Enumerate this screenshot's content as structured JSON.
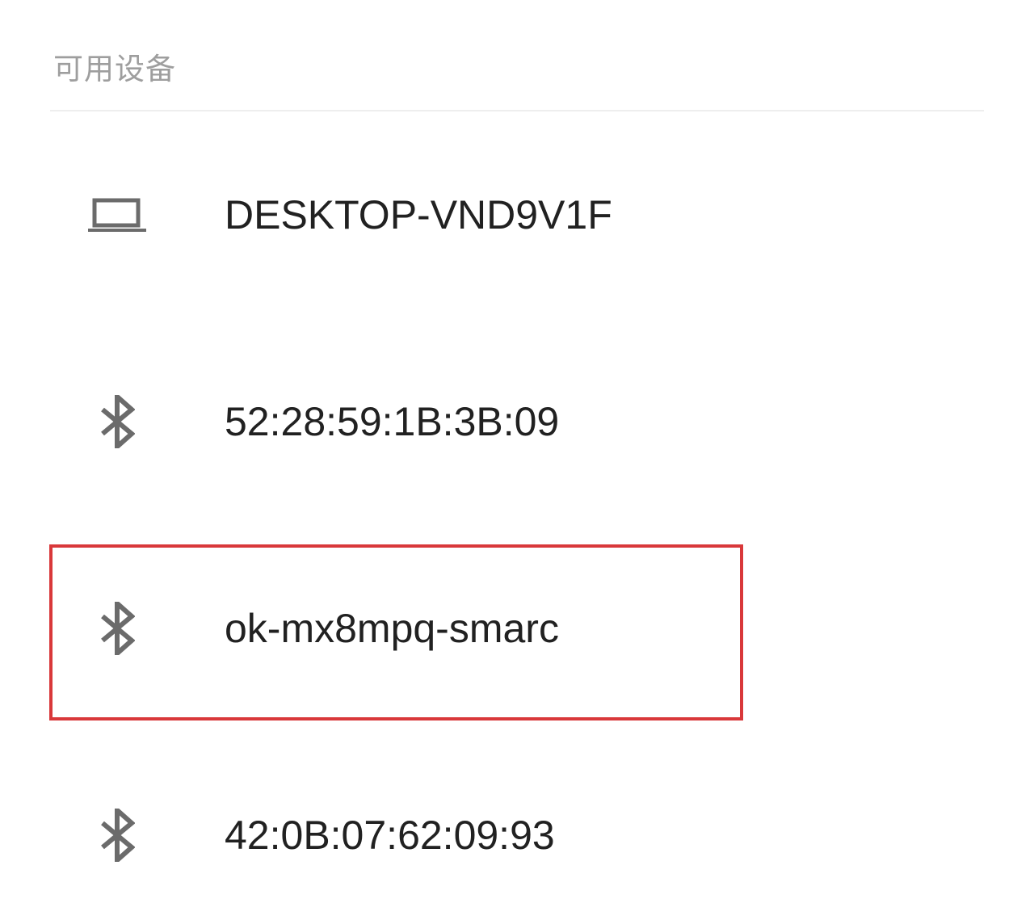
{
  "section": {
    "title": "可用设备"
  },
  "devices": [
    {
      "name": "DESKTOP-VND9V1F",
      "icon": "laptop-icon"
    },
    {
      "name": "52:28:59:1B:3B:09",
      "icon": "bluetooth-icon"
    },
    {
      "name": "ok-mx8mpq-smarc",
      "icon": "bluetooth-icon"
    },
    {
      "name": "42:0B:07:62:09:93",
      "icon": "bluetooth-icon"
    }
  ],
  "colors": {
    "icon": "#6b6b6b",
    "text": "#212121",
    "header": "#9e9e9e",
    "highlight": "#d9383a"
  }
}
